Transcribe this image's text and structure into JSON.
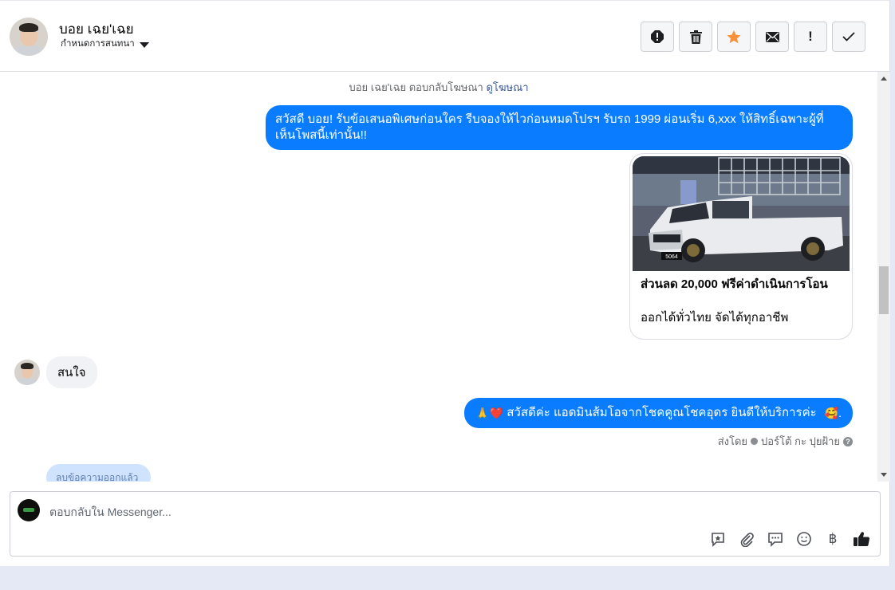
{
  "header": {
    "contact_name": "บอย เฉย'เฉย",
    "assign_label": "กำหนดการสนทนา",
    "actions": [
      {
        "name": "report-icon"
      },
      {
        "name": "trash-icon"
      },
      {
        "name": "star-icon",
        "color": "#f7923b"
      },
      {
        "name": "envelope-icon"
      },
      {
        "name": "exclamation-icon",
        "label": "!"
      },
      {
        "name": "check-icon"
      }
    ]
  },
  "chat": {
    "ad_note_text": "บอย เฉย'เฉย ตอบกลับโฆษณา",
    "ad_note_link": "ดูโฆษณา",
    "outgoing_message_1": "สวัสดี บอย! รับข้อเสนอพิเศษก่อนใคร รีบจองให้ไวก่อนหมดโปรฯ รับรถ 1999 ผ่อนเริ่ม 6,xxx ให้สิทธิ์เฉพาะผู้ที่เห็นโพสนี้เท่านั้น!!",
    "card": {
      "title": "ส่วนลด 20,000 ฟรีค่าดำเนินการโอน",
      "description": "ออกได้ทั่วไทย จัดได้ทุกอาชีพ",
      "plate": "5064"
    },
    "incoming_message": "สนใจ",
    "outgoing_message_2_prefix": "🙏❤️",
    "outgoing_message_2": "สวัสดีค่ะ แอดมินส้มโอจากโชคคูณโชคอุดร ยินดีให้บริการค่ะ",
    "outgoing_message_2_suffix": "🥰.",
    "sent_by_label": "ส่งโดย",
    "sent_by_name": "ปอร์โต้ กะ ปุยฝ้าย",
    "deleted_label": "ลบข้อความออกแล้ว"
  },
  "composer": {
    "placeholder": "ตอบกลับใน Messenger...",
    "tools": [
      "saved-reply-icon",
      "attachment-icon",
      "chat-bubble-icon",
      "emoji-icon",
      "baht-icon",
      "like-icon"
    ]
  },
  "colors": {
    "outgoing_bubble": "#0a7cff",
    "incoming_bubble": "#f0f2f5",
    "link": "#385898"
  }
}
